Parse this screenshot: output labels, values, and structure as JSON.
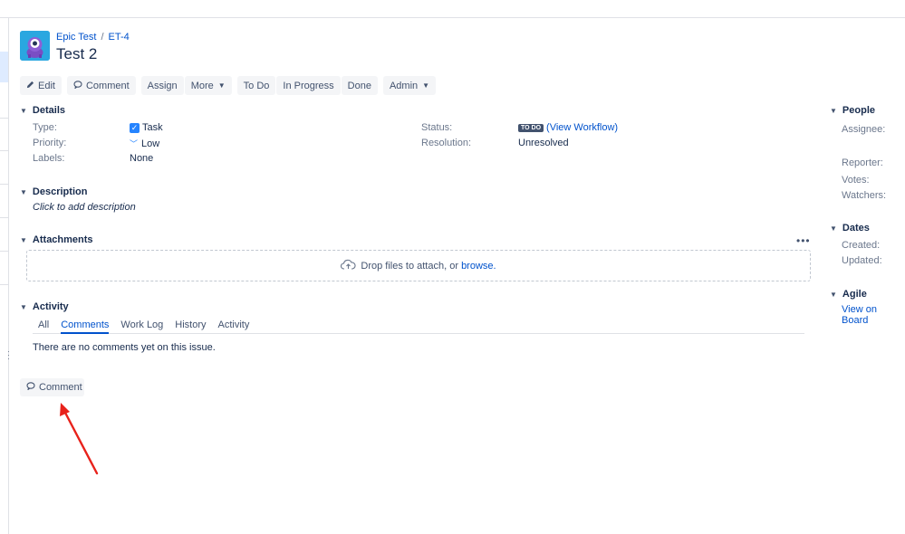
{
  "breadcrumb": {
    "project": "Epic Test",
    "separator": "/",
    "issue_key": "ET-4"
  },
  "issue": {
    "title": "Test 2"
  },
  "toolbar": {
    "edit": "Edit",
    "comment": "Comment",
    "assign": "Assign",
    "more": "More",
    "todo": "To Do",
    "in_progress": "In Progress",
    "done": "Done",
    "admin": "Admin"
  },
  "details": {
    "heading": "Details",
    "type_label": "Type:",
    "type_value": "Task",
    "priority_label": "Priority:",
    "priority_value": "Low",
    "labels_label": "Labels:",
    "labels_value": "None",
    "status_label": "Status:",
    "status_lozenge": "TO DO",
    "status_link": "(View Workflow)",
    "resolution_label": "Resolution:",
    "resolution_value": "Unresolved"
  },
  "description": {
    "heading": "Description",
    "placeholder": "Click to add description"
  },
  "attachments": {
    "heading": "Attachments",
    "more": "•••",
    "drop_text": "Drop files to attach, or",
    "browse": "browse."
  },
  "activity": {
    "heading": "Activity",
    "tabs": [
      "All",
      "Comments",
      "Work Log",
      "History",
      "Activity"
    ],
    "empty_text": "There are no comments yet on this issue.",
    "comment_button": "Comment"
  },
  "people": {
    "heading": "People",
    "assignee": "Assignee:",
    "reporter": "Reporter:",
    "votes": "Votes:",
    "watchers": "Watchers:"
  },
  "dates": {
    "heading": "Dates",
    "created": "Created:",
    "updated": "Updated:"
  },
  "agile": {
    "heading": "Agile",
    "link": "View on Board"
  },
  "icons": {
    "edit": "pencil-icon",
    "comment": "speech-bubble-icon",
    "chevron": "chevron-down-icon",
    "cloud": "cloud-upload-icon"
  },
  "colors": {
    "link": "#0052cc",
    "lozenge": "#42526e",
    "annotation_arrow": "#e8221b"
  }
}
